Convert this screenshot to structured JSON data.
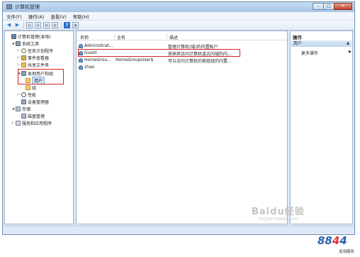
{
  "window": {
    "title": "计算机管理",
    "buttons": {
      "minimize": "–",
      "maximize": "□",
      "close": "✕"
    }
  },
  "menu": {
    "items": [
      "文件(F)",
      "操作(A)",
      "查看(V)",
      "帮助(H)"
    ]
  },
  "toolbar": {
    "back": "◀",
    "forward": "▶",
    "buttons": [
      "▤",
      "▥",
      "▧",
      "▨",
      "?",
      "▦"
    ]
  },
  "tree": {
    "items": [
      {
        "label": "计算机管理(本地)",
        "icon": "computer-icon",
        "expander": ""
      },
      {
        "label": "系统工具",
        "icon": "tools-icon",
        "expander": "◢"
      },
      {
        "label": "任务计划程序",
        "icon": "clock-icon",
        "expander": "▷"
      },
      {
        "label": "事件查看器",
        "icon": "viewer-icon",
        "expander": "▷"
      },
      {
        "label": "共享文件夹",
        "icon": "folder-icon",
        "expander": "▷"
      },
      {
        "label": "本地用户和组",
        "icon": "users-icon",
        "expander": "◢"
      },
      {
        "label": "用户",
        "icon": "folder-icon",
        "expander": ""
      },
      {
        "label": "组",
        "icon": "folder-icon",
        "expander": ""
      },
      {
        "label": "性能",
        "icon": "performance-icon",
        "expander": "▷"
      },
      {
        "label": "设备管理器",
        "icon": "device-icon",
        "expander": ""
      },
      {
        "label": "存储",
        "icon": "storage-icon",
        "expander": "◢"
      },
      {
        "label": "磁盘管理",
        "icon": "disk-icon",
        "expander": ""
      },
      {
        "label": "服务和应用程序",
        "icon": "services-icon",
        "expander": "▷"
      }
    ]
  },
  "list": {
    "columns": [
      "名称",
      "全名",
      "描述"
    ],
    "rows": [
      {
        "name": "Administrat...",
        "fullname": "",
        "description": "管理计算机(域)的内置帐户"
      },
      {
        "name": "Guest",
        "fullname": "",
        "description": "供来宾访问计算机或访问域的内..."
      },
      {
        "name": "HomeGrou...",
        "fullname": "HomeGroupUser$",
        "description": "可以访问计算机的家庭组的内置..."
      },
      {
        "name": "zhao",
        "fullname": "",
        "description": ""
      }
    ]
  },
  "actions": {
    "title": "操作",
    "section": "用户",
    "section_arrow": "▲",
    "link": "更多操作",
    "link_arrow": "▶"
  },
  "watermark": {
    "text": "Baidu经验",
    "sub": "jingyan.baidu.com"
  },
  "logo": {
    "digits_a": "88",
    "digits_b": "4",
    "digits_c": "4",
    "sub": "连用服务"
  },
  "colors": {
    "highlight": "#d42525",
    "accent": "#2d6fc9"
  }
}
